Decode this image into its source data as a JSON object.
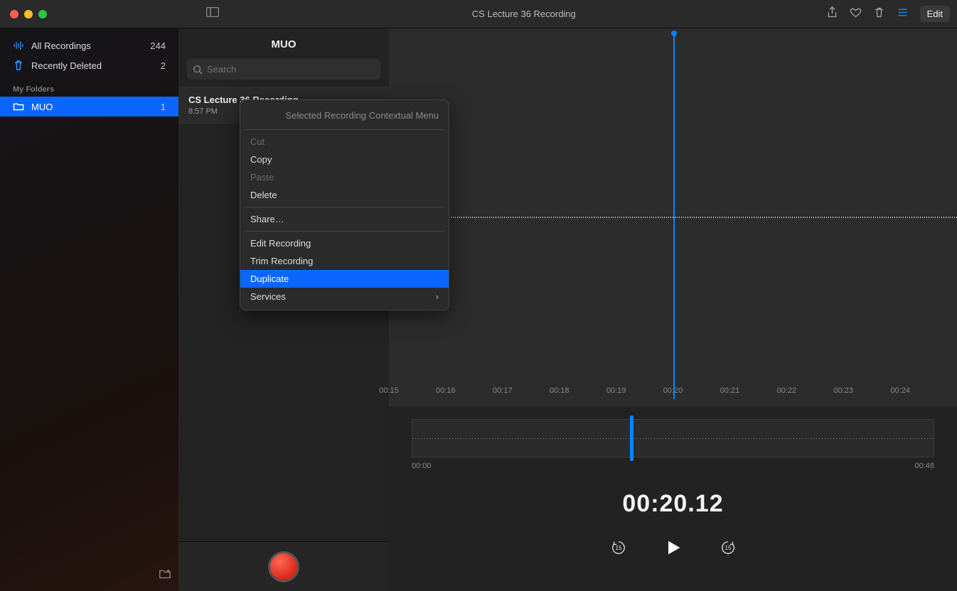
{
  "header": {
    "title": "CS Lecture 36 Recording",
    "edit_label": "Edit"
  },
  "sidebar": {
    "all_recordings": {
      "label": "All Recordings",
      "count": "244"
    },
    "recently_deleted": {
      "label": "Recently Deleted",
      "count": "2"
    },
    "section_label": "My Folders",
    "folders": [
      {
        "label": "MUO",
        "count": "1"
      }
    ]
  },
  "list": {
    "folder_title": "MUO",
    "search_placeholder": "Search",
    "items": [
      {
        "title": "CS Lecture 36 Recording",
        "time": "8:57 PM"
      }
    ]
  },
  "waveform": {
    "ticks": [
      "00:15",
      "00:16",
      "00:17",
      "00:18",
      "00:19",
      "00:20",
      "00:21",
      "00:22",
      "00:23",
      "00:24"
    ]
  },
  "player": {
    "start_time": "00:00",
    "end_time": "00:48",
    "current_time": "00:20.12",
    "skip_back_seconds": "15",
    "skip_forward_seconds": "15"
  },
  "context_menu": {
    "title": "Selected Recording Contextual Menu",
    "cut": "Cut",
    "copy": "Copy",
    "paste": "Paste",
    "delete": "Delete",
    "share": "Share…",
    "edit_recording": "Edit Recording",
    "trim_recording": "Trim Recording",
    "duplicate": "Duplicate",
    "services": "Services"
  }
}
